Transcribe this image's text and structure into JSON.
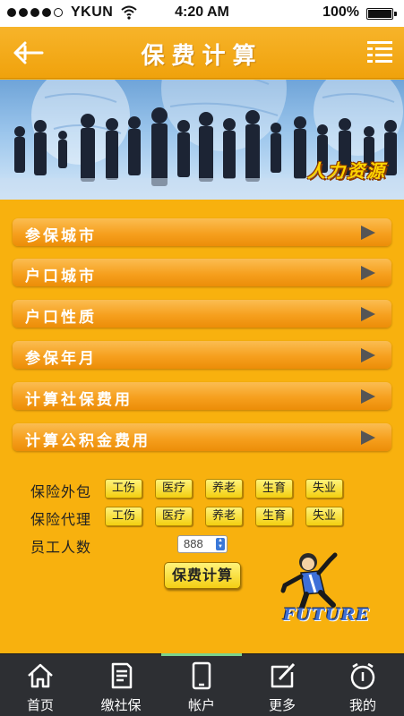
{
  "status_bar": {
    "carrier": "YKUN",
    "time": "4:20 AM",
    "battery": "100%",
    "signal_bars": 4,
    "signal_total": 5
  },
  "header": {
    "title": "保费计算",
    "back_icon": "back-arrow-icon",
    "menu_icon": "list-menu-icon"
  },
  "banner": {
    "caption": "人力资源"
  },
  "options": [
    {
      "label": "参保城市"
    },
    {
      "label": "户口城市"
    },
    {
      "label": "户口性质"
    },
    {
      "label": "参保年月"
    },
    {
      "label": "计算社保费用"
    },
    {
      "label": "计算公积金费用"
    }
  ],
  "insurance_rows": [
    {
      "label": "保险外包",
      "items": [
        "工伤",
        "医疗",
        "养老",
        "生育",
        "失业"
      ]
    },
    {
      "label": "保险代理",
      "items": [
        "工伤",
        "医疗",
        "养老",
        "生育",
        "失业"
      ]
    }
  ],
  "employee_count": {
    "label": "员工人数",
    "value": "888"
  },
  "calc_button": "保费计算",
  "mascot_text": "FUTURE",
  "tabs": [
    {
      "label": "首页",
      "icon": "home-icon",
      "active": false
    },
    {
      "label": "缴社保",
      "icon": "document-icon",
      "active": false
    },
    {
      "label": "帐户",
      "icon": "phone-icon",
      "active": true
    },
    {
      "label": "更多",
      "icon": "edit-icon",
      "active": false
    },
    {
      "label": "我的",
      "icon": "clock-icon",
      "active": false
    }
  ],
  "colors": {
    "background": "#f8b10e",
    "tab_bar": "#2d2f33",
    "active_tab_indicator": "#7bd38c",
    "banner_caption": "#ffd400"
  }
}
